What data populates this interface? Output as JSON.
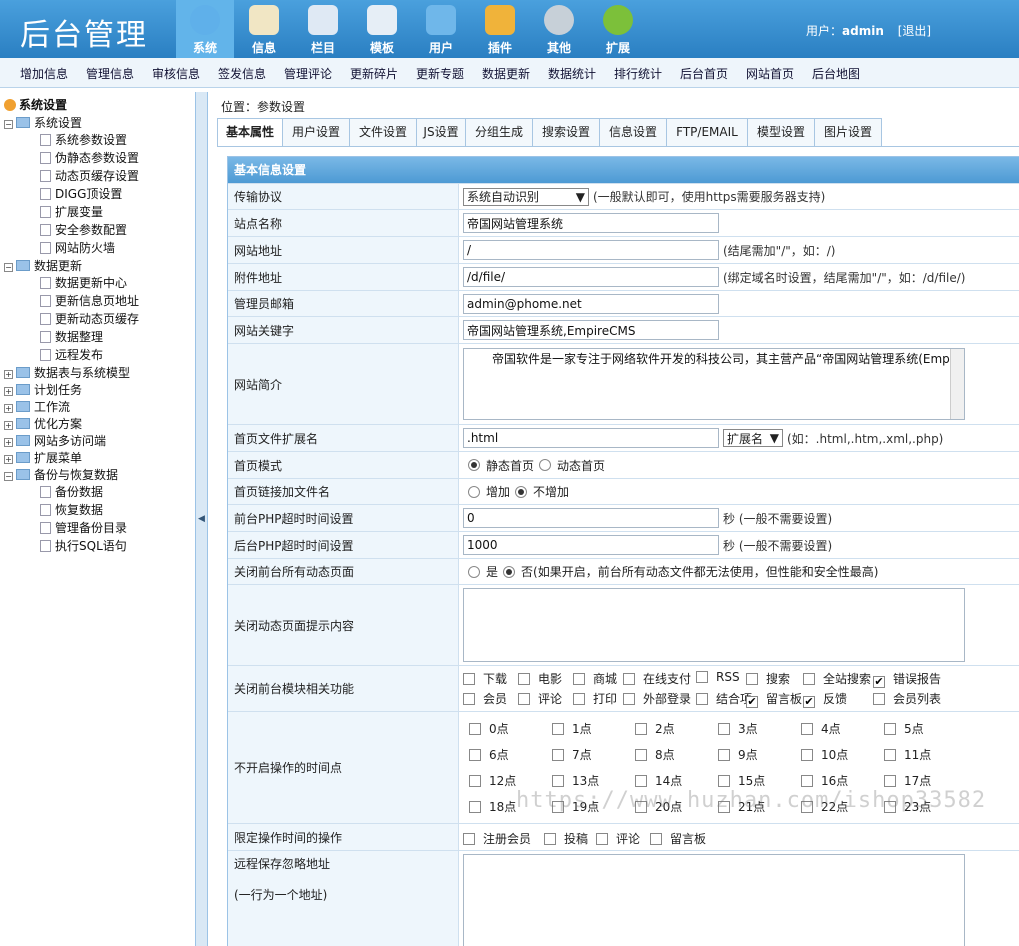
{
  "app": {
    "logo": "后台管理"
  },
  "top_nav": [
    {
      "label": "系统",
      "icon": "globe-icon",
      "color": "#5fb0ea",
      "active": true
    },
    {
      "label": "信息",
      "icon": "document-edit-icon",
      "color": "#f1e6c4"
    },
    {
      "label": "栏目",
      "icon": "folder-icon",
      "color": "#dfe9f4"
    },
    {
      "label": "模板",
      "icon": "window-template-icon",
      "color": "#e6eef6"
    },
    {
      "label": "用户",
      "icon": "user-icon",
      "color": "#6fb7ea"
    },
    {
      "label": "插件",
      "icon": "tools-icon",
      "color": "#f0b33a"
    },
    {
      "label": "其他",
      "icon": "gear-icon",
      "color": "#c7d0d8"
    },
    {
      "label": "扩展",
      "icon": "plus-circle-icon",
      "color": "#7cc03a"
    }
  ],
  "user": {
    "label": "用户：",
    "name": "admin",
    "logout": "[退出]"
  },
  "sub_nav": [
    "增加信息",
    "管理信息",
    "审核信息",
    "签发信息",
    "管理评论",
    "更新碎片",
    "更新专题",
    "数据更新",
    "数据统计",
    "排行统计",
    "后台首页",
    "网站首页",
    "后台地图"
  ],
  "tree": {
    "root": "系统设置",
    "groups": [
      {
        "label": "系统设置",
        "expanded": true,
        "items": [
          "系统参数设置",
          "伪静态参数设置",
          "动态页缓存设置",
          "DIGG顶设置",
          "扩展变量",
          "安全参数配置",
          "网站防火墙"
        ]
      },
      {
        "label": "数据更新",
        "expanded": true,
        "items": [
          "数据更新中心",
          "更新信息页地址",
          "更新动态页缓存",
          "数据整理",
          "远程发布"
        ]
      },
      {
        "label": "数据表与系统模型",
        "expanded": false,
        "items": []
      },
      {
        "label": "计划任务",
        "expanded": false,
        "items": []
      },
      {
        "label": "工作流",
        "expanded": false,
        "items": []
      },
      {
        "label": "优化方案",
        "expanded": false,
        "items": []
      },
      {
        "label": "网站多访问端",
        "expanded": false,
        "items": []
      },
      {
        "label": "扩展菜单",
        "expanded": false,
        "items": []
      },
      {
        "label": "备份与恢复数据",
        "expanded": true,
        "items": [
          "备份数据",
          "恢复数据",
          "管理备份目录",
          "执行SQL语句"
        ]
      }
    ]
  },
  "splitter": {
    "arrow": "◀"
  },
  "location": "位置：参数设置",
  "tabs": [
    "基本属性",
    "用户设置",
    "文件设置",
    "JS设置",
    "分组生成",
    "搜索设置",
    "信息设置",
    "FTP/EMAIL",
    "模型设置",
    "图片设置"
  ],
  "form": {
    "title": "基本信息设置",
    "protocol": {
      "label": "传输协议",
      "value": "系统自动识别",
      "note": "(一般默认即可，使用https需要服务器支持)"
    },
    "site_name": {
      "label": "站点名称",
      "value": "帝国网站管理系统"
    },
    "site_url": {
      "label": "网站地址",
      "value": "/",
      "note": "(结尾需加\"/\"，如：/)"
    },
    "attach_url": {
      "label": "附件地址",
      "value": "/d/file/",
      "note": "(绑定域名时设置，结尾需加\"/\"，如：/d/file/)"
    },
    "admin_email": {
      "label": "管理员邮箱",
      "value": "admin@phome.net"
    },
    "keywords": {
      "label": "网站关键字",
      "value": "帝国网站管理系统,EmpireCMS"
    },
    "intro": {
      "label": "网站简介",
      "value": "　　帝国软件是一家专注于网络软件开发的科技公司，其主营产品“帝国网站管理系统(EmpireCMS)”是目前国内应用超广泛的CMS程序。通过十多年的不断创新与完善，使系统集安全、稳定、强大、灵活于一身。目前EmpireCMS程序已经广泛应用在国内上百万家网站，覆盖国内数千万上网人群，并经过上千家知名网站的严格检测，被称为国内超高安全、超高稳定的开源CMS系统。"
    },
    "index_ext": {
      "label": "首页文件扩展名",
      "value": ".html",
      "select": "扩展名",
      "note": "(如：.html,.htm,.xml,.php)"
    },
    "index_mode": {
      "label": "首页模式",
      "options": [
        {
          "text": "静态首页",
          "checked": true
        },
        {
          "text": "动态首页",
          "checked": false
        }
      ]
    },
    "index_link": {
      "label": "首页链接加文件名",
      "options": [
        {
          "text": "增加",
          "checked": false
        },
        {
          "text": "不增加",
          "checked": true
        }
      ]
    },
    "front_timeout": {
      "label": "前台PHP超时时间设置",
      "value": "0",
      "note": "秒 (一般不需要设置)"
    },
    "back_timeout": {
      "label": "后台PHP超时时间设置",
      "value": "1000",
      "note": "秒 (一般不需要设置)"
    },
    "close_dynamic": {
      "label": "关闭前台所有动态页面",
      "options": [
        {
          "text": "是",
          "checked": false
        },
        {
          "text": "否",
          "checked": true
        }
      ],
      "note": "(如果开启，前台所有动态文件都无法使用，但性能和安全性最高)"
    },
    "close_tip": {
      "label": "关闭动态页面提示内容",
      "value": ""
    },
    "close_modules": {
      "label": "关闭前台模块相关功能",
      "items": [
        {
          "text": "下载",
          "checked": false
        },
        {
          "text": "电影",
          "checked": false
        },
        {
          "text": "商城",
          "checked": false
        },
        {
          "text": "在线支付",
          "checked": false
        },
        {
          "text": "RSS",
          "checked": false
        },
        {
          "text": "搜索",
          "checked": false
        },
        {
          "text": "全站搜索",
          "checked": false
        },
        {
          "text": "错误报告",
          "checked": true
        },
        {
          "text": "会员",
          "checked": false
        },
        {
          "text": "评论",
          "checked": false
        },
        {
          "text": "打印",
          "checked": false
        },
        {
          "text": "外部登录",
          "checked": false
        },
        {
          "text": "结合项",
          "checked": false
        },
        {
          "text": "留言板",
          "checked": true
        },
        {
          "text": "反馈",
          "checked": true
        },
        {
          "text": "会员列表",
          "checked": false
        }
      ]
    },
    "closed_hours": {
      "label": "不开启操作的时间点",
      "hours": [
        "0点",
        "1点",
        "2点",
        "3点",
        "4点",
        "5点",
        "6点",
        "7点",
        "8点",
        "9点",
        "10点",
        "11点",
        "12点",
        "13点",
        "14点",
        "15点",
        "16点",
        "17点",
        "18点",
        "19点",
        "20点",
        "21点",
        "22点",
        "23点"
      ]
    },
    "limit_ops": {
      "label": "限定操作时间的操作",
      "items": [
        {
          "text": "注册会员",
          "checked": false
        },
        {
          "text": "投稿",
          "checked": false
        },
        {
          "text": "评论",
          "checked": false
        },
        {
          "text": "留言板",
          "checked": false
        }
      ]
    },
    "remote_ignore": {
      "label": "远程保存忽略地址",
      "sublabel": "(一行为一个地址)",
      "value": ""
    }
  },
  "watermark": "https://www.huzhan.com/ishop33582"
}
